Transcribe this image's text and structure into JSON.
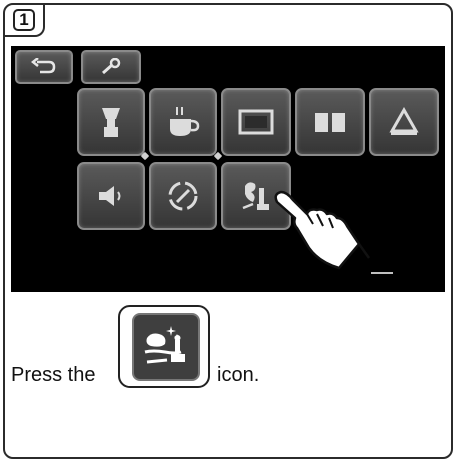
{
  "step": {
    "number": "1"
  },
  "screen": {
    "top_row": [
      {
        "icon": "back-arrow-icon"
      },
      {
        "icon": "wrench-icon"
      }
    ],
    "grid_row1": [
      {
        "icon": "coffee-grinder-icon"
      },
      {
        "icon": "cup-steam-icon"
      },
      {
        "icon": "display-screen-icon"
      },
      {
        "icon": "book-icon"
      },
      {
        "icon": "cleaning-icon"
      }
    ],
    "grid_row2": [
      {
        "icon": "speaker-icon"
      },
      {
        "icon": "descale-cycle-icon"
      },
      {
        "icon": "milk-cleaning-icon"
      }
    ]
  },
  "instruction": {
    "before": "Press the",
    "after": "icon.",
    "icon": "milk-cleaning-icon"
  },
  "colors": {
    "screen_bg": "#000000",
    "tile_border": "#8a8a8a",
    "frame": "#2b2b2b"
  }
}
